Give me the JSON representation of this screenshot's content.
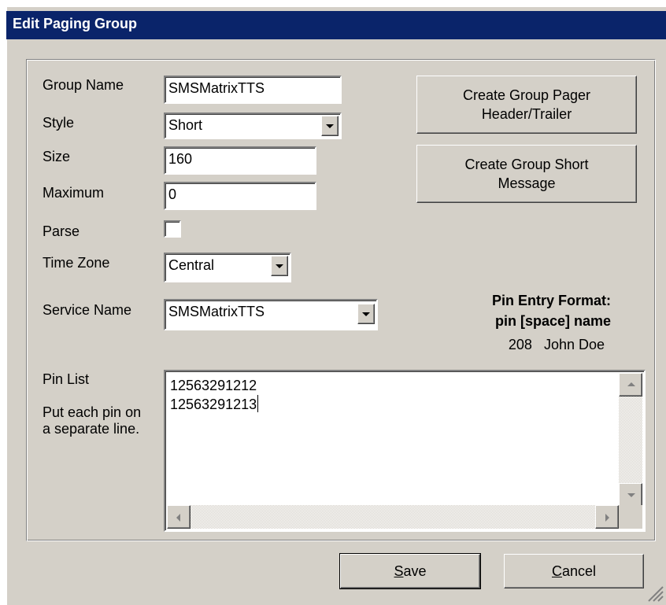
{
  "window": {
    "title": "Edit Paging Group"
  },
  "form": {
    "group_name": {
      "label": "Group Name",
      "value": "SMSMatrixTTS"
    },
    "style": {
      "label": "Style",
      "value": "Short"
    },
    "size": {
      "label": "Size",
      "value": "160"
    },
    "maximum": {
      "label": "Maximum",
      "value": "0"
    },
    "parse": {
      "label": "Parse",
      "checked": false
    },
    "time_zone": {
      "label": "Time Zone",
      "value": "Central"
    },
    "service_name": {
      "label": "Service Name",
      "value": "SMSMatrixTTS"
    },
    "pin_list": {
      "label": "Pin List",
      "hint": "Put each pin on a separate line.",
      "lines": [
        "12563291212",
        "12563291213"
      ]
    }
  },
  "buttons": {
    "create_header_trailer": {
      "line1": "Create Group Pager",
      "line2": "Header/Trailer"
    },
    "create_short_message": {
      "line1": "Create Group Short",
      "line2": "Message"
    },
    "save": {
      "accel": "S",
      "rest": "ave"
    },
    "cancel": {
      "accel": "C",
      "rest": "ancel"
    }
  },
  "pin_format": {
    "title": "Pin Entry Format:",
    "syntax": "pin [space] name",
    "example": "208   John Doe"
  },
  "icons": [
    "dropdown-arrow-icon",
    "scroll-up-icon",
    "scroll-down-icon",
    "scroll-left-icon",
    "scroll-right-icon",
    "resize-grip-icon"
  ],
  "colors": {
    "titlebar": "#0a246a",
    "face": "#d4d0c8"
  }
}
